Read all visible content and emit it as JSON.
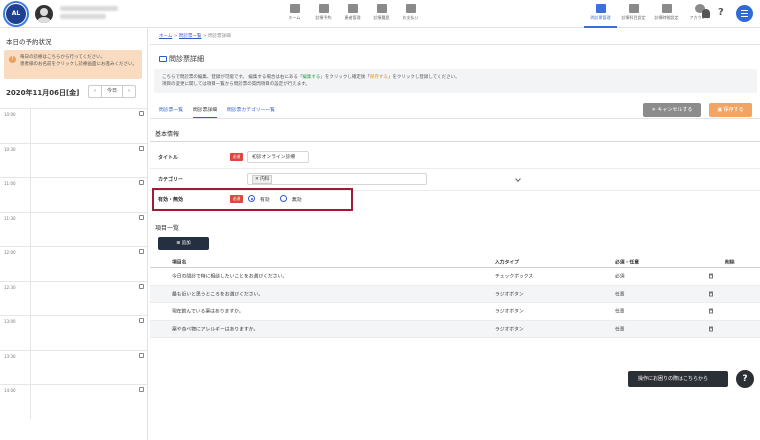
{
  "header": {
    "logo_text": "AL",
    "nav_center": [
      {
        "label": "ホーム",
        "icon": "home-icon"
      },
      {
        "label": "診療予約",
        "icon": "calendar-icon"
      },
      {
        "label": "患者管理",
        "icon": "patient-icon"
      },
      {
        "label": "診療履歴",
        "icon": "history-icon"
      },
      {
        "label": "お支払い",
        "icon": "payment-icon"
      }
    ],
    "nav_right": [
      {
        "label": "問診票管理",
        "icon": "folder-icon",
        "active": true
      },
      {
        "label": "診療科目設定",
        "icon": "clinic-settings-icon"
      },
      {
        "label": "診療時間設定",
        "icon": "clock-settings-icon"
      },
      {
        "label": "アカウント",
        "icon": "account-icon"
      }
    ],
    "help_glyph": "?"
  },
  "left": {
    "title": "本日の予約状況",
    "notice": "毎日の診療はこちらから行ってください。\n患者様のお名前をクリックし診療画面にお進みください。",
    "date": "2020年11月06日[金]",
    "today_label": "今日",
    "prev": "‹",
    "next": "›",
    "times": [
      "10:00",
      "10:30",
      "11:00",
      "11:30",
      "12:00",
      "12:30",
      "13:00",
      "13:30",
      "14:00"
    ]
  },
  "main": {
    "breadcrumb_home": "ホーム",
    "breadcrumb_list": "問診票一覧",
    "breadcrumb_current": "問診票詳細",
    "title": "問診票詳細",
    "desc_1": "こちらで問診票の編集、登録が可能です。 編集する場合は右にある「",
    "desc_edit": "編集する",
    "desc_2": "」をクリックし確定後「",
    "desc_save": "保存する",
    "desc_3": "」をクリックし登録してください。",
    "desc_line2": "項目の変更に関しては項目一覧から問診票の質問項目の設定が行えます。",
    "tabs": [
      "問診票一覧",
      "問診票詳細",
      "問診票カテゴリー一覧"
    ],
    "cancel_label": "キャンセルする",
    "save_label": "保存する",
    "basic_info": "基本情報",
    "field_title_label": "タイトル",
    "field_title_value": "初診オンライン診療",
    "required_badge": "必須",
    "field_category_label": "カテゴリー",
    "field_category_value": "内科",
    "field_status_label": "有効・無効",
    "radio_enabled": "有効",
    "radio_disabled": "無効",
    "items_title": "項目一覧",
    "add_label": "追加",
    "table_headers": [
      "項目名",
      "入力タイプ",
      "必須・任意",
      "削除"
    ],
    "rows": [
      {
        "name": "今日の問診で特に相談したいことをお選びください。",
        "type": "チェックボックス",
        "req": "必須"
      },
      {
        "name": "最も近いと思うところをお選びください。",
        "type": "ラジオボタン",
        "req": "任意"
      },
      {
        "name": "現在飲んでいる薬はありますか。",
        "type": "ラジオボタン",
        "req": "任意"
      },
      {
        "name": "薬や食べ物にアレルギーはありますか。",
        "type": "ラジオボタン",
        "req": "任意"
      }
    ]
  },
  "floating_help": {
    "label": "操作にお困りの際はこちらから",
    "glyph": "?"
  },
  "colors": {
    "accent": "#2f5ec8",
    "highlight_border": "#a3193a",
    "save": "#f3a462",
    "cancel": "#8c8c8c",
    "required": "#e0463f"
  }
}
